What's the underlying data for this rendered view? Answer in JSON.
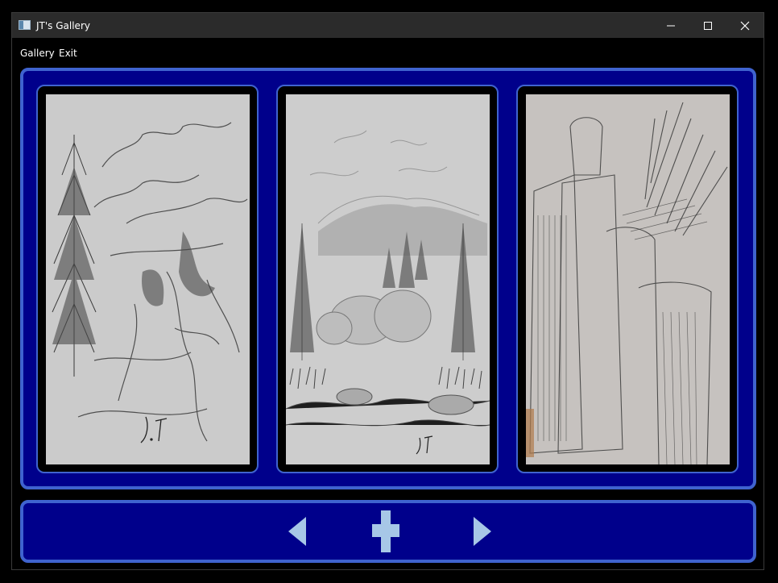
{
  "window": {
    "title": "JT's Gallery",
    "icon": "app-window-icon",
    "controls": {
      "minimize_icon": "minimize-icon",
      "maximize_icon": "maximize-icon",
      "close_icon": "close-icon"
    }
  },
  "menu": {
    "items": [
      {
        "label": "Gallery"
      },
      {
        "label": "Exit"
      }
    ]
  },
  "gallery": {
    "images": [
      {
        "subject": "pencil sketch of pine trees by a lake",
        "signature": "J.T"
      },
      {
        "subject": "pencil sketch of forest with boulders and grass",
        "signature": "J.T"
      },
      {
        "subject": "pencil sketch of bottles and pencils in a cup",
        "signature": ""
      }
    ]
  },
  "navigation": {
    "prev_icon": "triangle-left-icon",
    "add_icon": "plus-icon",
    "next_icon": "triangle-right-icon"
  },
  "colors": {
    "panel_background": "#00008b",
    "panel_border": "#3f63cf",
    "nav_icon": "#a7c7e7",
    "titlebar": "#2b2b2b"
  }
}
